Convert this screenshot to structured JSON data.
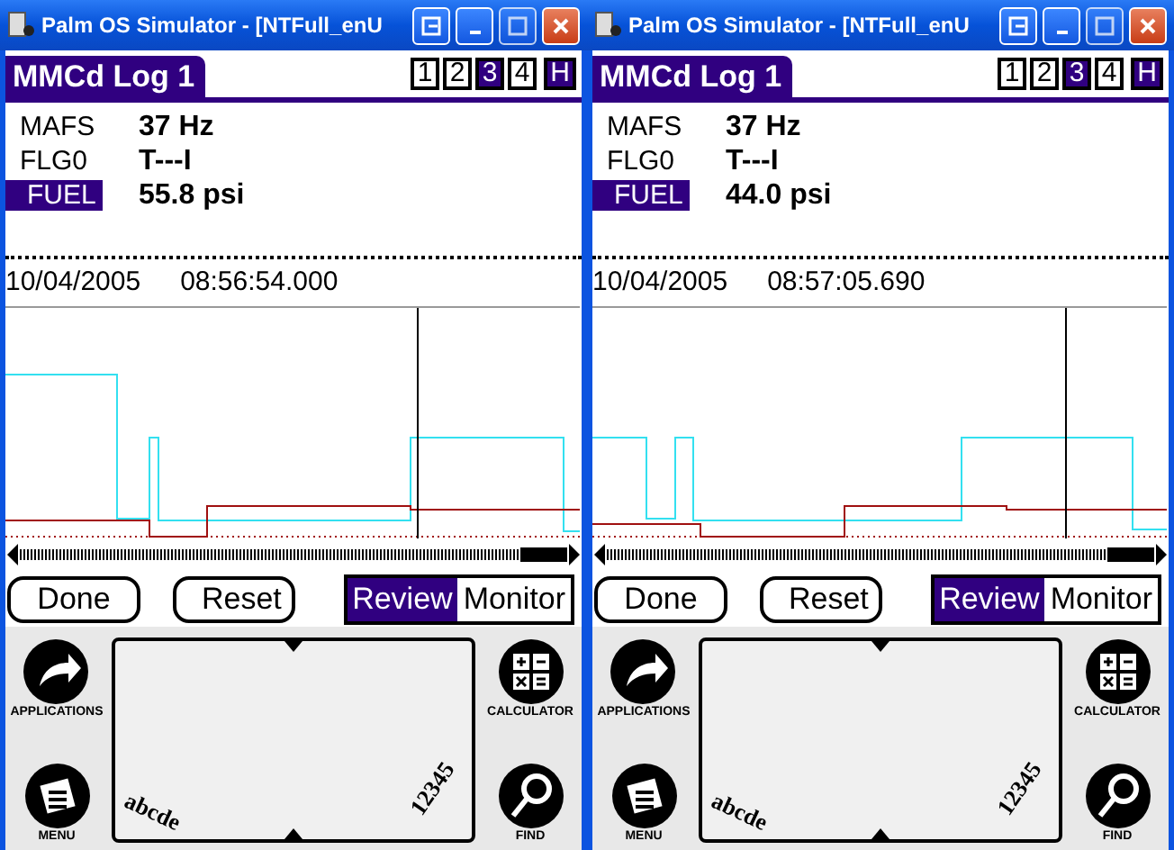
{
  "windows": [
    {
      "title": "Palm OS Simulator - [NTFull_enU",
      "app_title": "MMCd Log 1",
      "page_tabs": [
        {
          "label": "1",
          "selected": false
        },
        {
          "label": "2",
          "selected": false
        },
        {
          "label": "3",
          "selected": true
        },
        {
          "label": "4",
          "selected": false
        }
      ],
      "history_button": "H",
      "fields": [
        {
          "name": "MAFS",
          "value": "37 Hz",
          "selected": false
        },
        {
          "name": "FLG0",
          "value": "T---I",
          "selected": false
        },
        {
          "name": "FUEL",
          "value": "55.8 psi",
          "selected": true
        }
      ],
      "date": "10/04/2005",
      "time": "08:56:54.000",
      "buttons": [
        "Done",
        "Reset"
      ],
      "modes": [
        {
          "label": "Review",
          "selected": true
        },
        {
          "label": "Monitor",
          "selected": false
        }
      ],
      "graffiti": {
        "applications": "APPLICATIONS",
        "menu": "MENU",
        "calculator": "CALCULATOR",
        "find": "FIND",
        "letters": "abcde",
        "numbers": "12345"
      }
    },
    {
      "title": "Palm OS Simulator - [NTFull_enU",
      "app_title": "MMCd Log 1",
      "page_tabs": [
        {
          "label": "1",
          "selected": false
        },
        {
          "label": "2",
          "selected": false
        },
        {
          "label": "3",
          "selected": true
        },
        {
          "label": "4",
          "selected": false
        }
      ],
      "history_button": "H",
      "fields": [
        {
          "name": "MAFS",
          "value": "37 Hz",
          "selected": false
        },
        {
          "name": "FLG0",
          "value": "T---I",
          "selected": false
        },
        {
          "name": "FUEL",
          "value": "44.0 psi",
          "selected": true
        }
      ],
      "date": "10/04/2005",
      "time": "08:57:05.690",
      "buttons": [
        "Done",
        "Reset"
      ],
      "modes": [
        {
          "label": "Review",
          "selected": true
        },
        {
          "label": "Monitor",
          "selected": false
        }
      ],
      "graffiti": {
        "applications": "APPLICATIONS",
        "menu": "MENU",
        "calculator": "CALCULATOR",
        "find": "FIND",
        "letters": "abcde",
        "numbers": "12345"
      }
    }
  ]
}
